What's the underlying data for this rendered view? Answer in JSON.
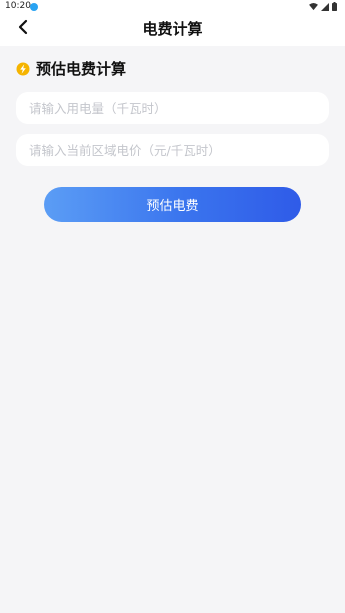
{
  "status_bar": {
    "time": "10:20",
    "icons": [
      "notification-dot-icon",
      "wifi-icon",
      "signal-icon",
      "battery-icon"
    ]
  },
  "nav": {
    "title": "电费计算",
    "back_icon": "chevron-left-icon"
  },
  "section": {
    "icon": "lightning-bolt-icon",
    "title": "预估电费计算"
  },
  "form": {
    "usage_placeholder": "请输入用电量（千瓦时）",
    "usage_value": "",
    "price_placeholder": "请输入当前区域电价（元/千瓦时）",
    "price_value": "",
    "submit_label": "预估电费"
  },
  "colors": {
    "accent_start": "#5b9df5",
    "accent_end": "#2f5be8",
    "bolt_yellow": "#f5b400",
    "background": "#f5f5f7"
  }
}
